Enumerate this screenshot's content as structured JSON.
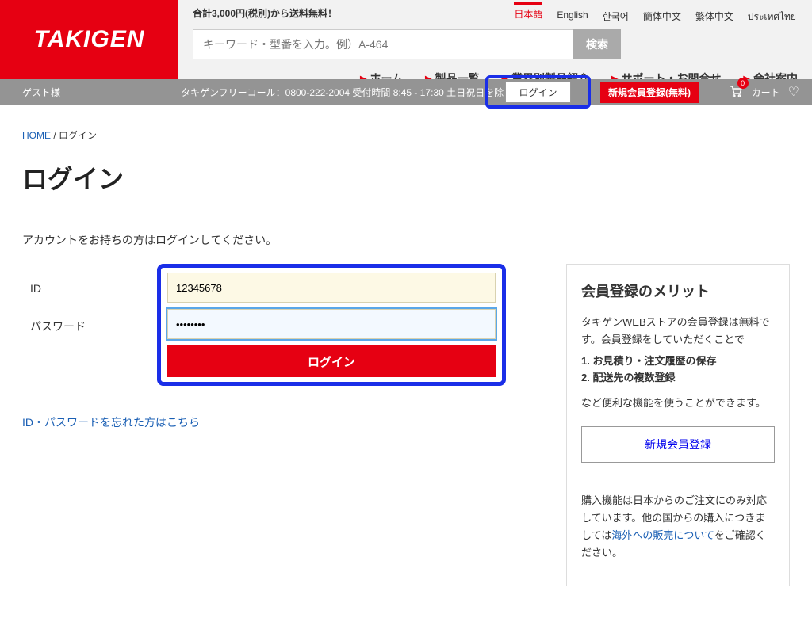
{
  "header": {
    "logo": "TAKIGEN",
    "shipping_note": "合計3,000円(税別)から送料無料！",
    "languages": [
      "日本語",
      "English",
      "한국어",
      "簡体中文",
      "繁体中文",
      "ประเทศไทย"
    ],
    "active_lang_index": 0,
    "search_placeholder": "キーワード・型番を入力。例）A-464",
    "search_button": "検索",
    "nav": [
      "ホーム",
      "製品一覧",
      "業界別製品紹介",
      "サポート・お問合せ",
      "会社案内"
    ]
  },
  "util": {
    "guest": "ゲスト様",
    "freecall": "タキゲンフリーコール：0800-222-2004 受付時間 8:45 - 17:30 土日祝日を除く",
    "login": "ログイン",
    "register": "新規会員登録(無料)",
    "cart_label": "カート",
    "cart_count": "0"
  },
  "breadcrumb": {
    "home": "HOME",
    "sep": " / ",
    "current": "ログイン"
  },
  "page": {
    "title": "ログイン",
    "subtitle": "アカウントをお持ちの方はログインしてください。",
    "id_label": "ID",
    "pw_label": "パスワード",
    "id_value": "12345678",
    "pw_value": "••••••••",
    "login_btn": "ログイン",
    "forgot": "ID・パスワードを忘れた方はこちら"
  },
  "sidebar": {
    "title": "会員登録のメリット",
    "intro": "タキゲンWEBストアの会員登録は無料です。会員登録をしていただくことで",
    "benefits": [
      "1. お見積り・注文履歴の保存",
      "2. 配送先の複数登録"
    ],
    "outro": "など便利な機能を使うことができます。",
    "register_btn": "新規会員登録",
    "note1": "購入機能は日本からのご注文にのみ対応しています。他の国からの購入につきましては",
    "note_link": "海外への販売について",
    "note2": "をご確認ください。"
  }
}
